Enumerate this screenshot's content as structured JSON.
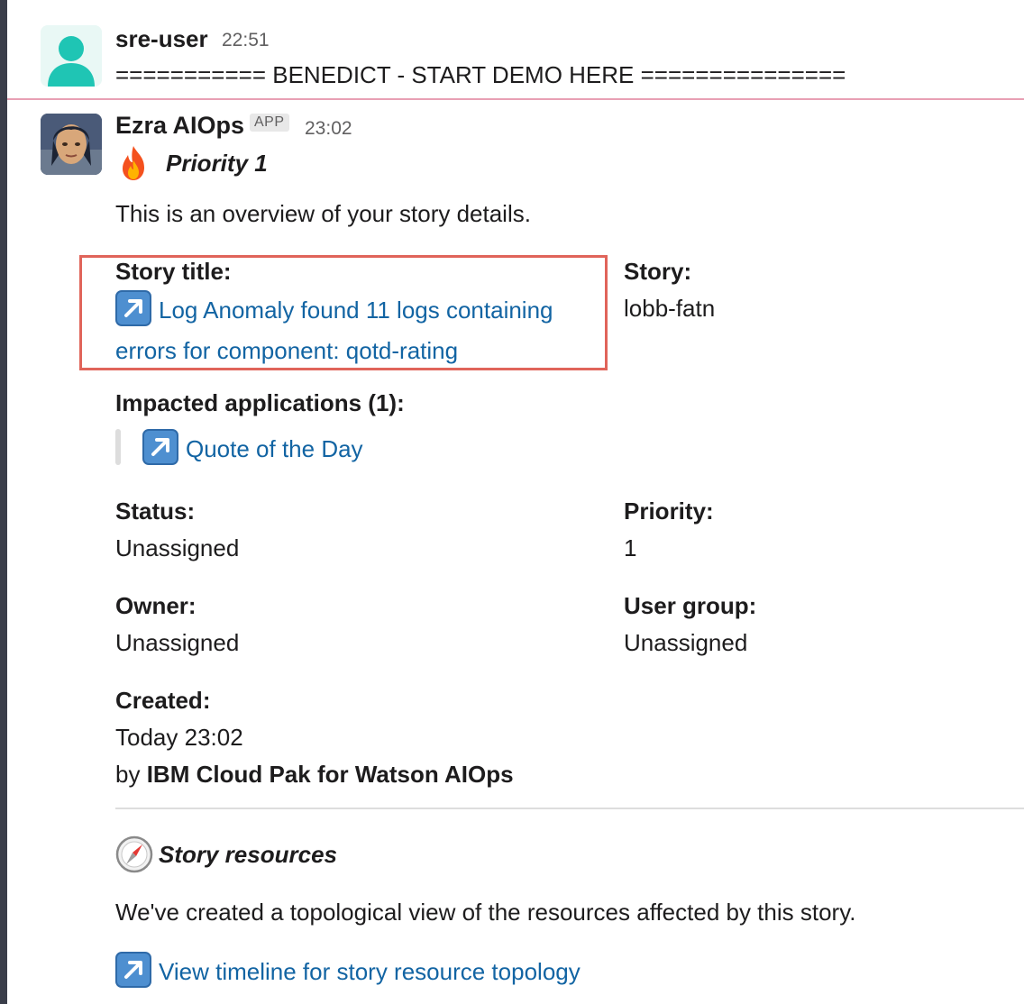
{
  "messages": {
    "sre": {
      "author": "sre-user",
      "time": "22:51",
      "text": "=========== BENEDICT - START DEMO HERE ==============="
    },
    "ezra": {
      "author": "Ezra AIOps",
      "badge": "APP",
      "time": "23:02",
      "priority_heading": "Priority 1",
      "overview": "This is an overview of your story details.",
      "fields": {
        "story_title_label": "Story title:",
        "story_title_link": "Log Anomaly found 11 logs containing errors for component: qotd-rating",
        "story_label": "Story:",
        "story_value": "lobb-fatn",
        "impacted_label": "Impacted applications (1):",
        "impacted_app": "Quote of the Day",
        "status_label": "Status:",
        "status_value": "Unassigned",
        "priority_label": "Priority:",
        "priority_value": "1",
        "owner_label": "Owner:",
        "owner_value": "Unassigned",
        "user_group_label": "User group:",
        "user_group_value": "Unassigned",
        "created_label": "Created:",
        "created_value": "Today 23:02",
        "created_by_prefix": "by",
        "created_by_name": "IBM Cloud Pak for Watson AIOps"
      },
      "resources": {
        "heading": "Story resources",
        "text": "We've created a topological view of the resources affected by this story.",
        "link": "View timeline for story resource topology"
      }
    }
  },
  "colors": {
    "link": "#1264a3",
    "highlight_border": "#e0645a",
    "avatar_teal": "#1fc5b4"
  },
  "icons": [
    "person-avatar-icon",
    "fire-icon",
    "external-link-arrow-icon",
    "compass-icon"
  ]
}
